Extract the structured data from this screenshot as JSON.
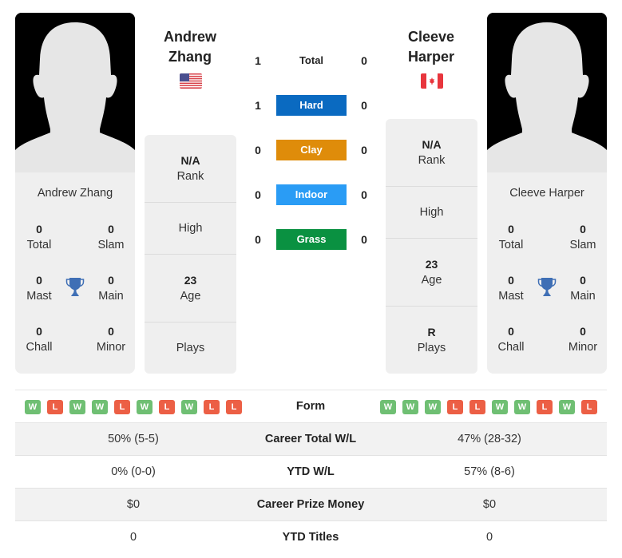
{
  "players": {
    "left": {
      "name_line1": "Andrew",
      "name_line2": "Zhang",
      "full_name": "Andrew Zhang",
      "country_flag": "us-flag-icon",
      "titles": {
        "total": {
          "value": "0",
          "label": "Total"
        },
        "slam": {
          "value": "0",
          "label": "Slam"
        },
        "mast": {
          "value": "0",
          "label": "Mast"
        },
        "main": {
          "value": "0",
          "label": "Main"
        },
        "chall": {
          "value": "0",
          "label": "Chall"
        },
        "minor": {
          "value": "0",
          "label": "Minor"
        }
      },
      "info": {
        "rank": {
          "value": "N/A",
          "label": "Rank"
        },
        "high": {
          "value": "",
          "label": "High"
        },
        "age": {
          "value": "23",
          "label": "Age"
        },
        "plays": {
          "value": "",
          "label": "Plays"
        }
      },
      "form": [
        "W",
        "L",
        "W",
        "W",
        "L",
        "W",
        "L",
        "W",
        "L",
        "L"
      ]
    },
    "right": {
      "name_line1": "Cleeve",
      "name_line2": "Harper",
      "full_name": "Cleeve Harper",
      "country_flag": "canada-flag-icon",
      "titles": {
        "total": {
          "value": "0",
          "label": "Total"
        },
        "slam": {
          "value": "0",
          "label": "Slam"
        },
        "mast": {
          "value": "0",
          "label": "Mast"
        },
        "main": {
          "value": "0",
          "label": "Main"
        },
        "chall": {
          "value": "0",
          "label": "Chall"
        },
        "minor": {
          "value": "0",
          "label": "Minor"
        }
      },
      "info": {
        "rank": {
          "value": "N/A",
          "label": "Rank"
        },
        "high": {
          "value": "",
          "label": "High"
        },
        "age": {
          "value": "23",
          "label": "Age"
        },
        "plays": {
          "value": "R",
          "label": "Plays"
        }
      },
      "form": [
        "W",
        "W",
        "W",
        "L",
        "L",
        "W",
        "W",
        "L",
        "W",
        "L"
      ]
    }
  },
  "h2h": [
    {
      "label": "Total",
      "left": "1",
      "right": "0",
      "color": ""
    },
    {
      "label": "Hard",
      "left": "1",
      "right": "0",
      "color": "#0a6ac1"
    },
    {
      "label": "Clay",
      "left": "0",
      "right": "0",
      "color": "#df8c0a"
    },
    {
      "label": "Indoor",
      "left": "0",
      "right": "0",
      "color": "#2a9cf5"
    },
    {
      "label": "Grass",
      "left": "0",
      "right": "0",
      "color": "#0a9141"
    }
  ],
  "form_label": "Form",
  "form_colors": {
    "W": "#6fbf73",
    "L": "#ec5f45"
  },
  "stats": [
    {
      "label": "Career Total W/L",
      "left": "50% (5-5)",
      "right": "47% (28-32)"
    },
    {
      "label": "YTD W/L",
      "left": "0% (0-0)",
      "right": "57% (8-6)"
    },
    {
      "label": "Career Prize Money",
      "left": "$0",
      "right": "$0"
    },
    {
      "label": "YTD Titles",
      "left": "0",
      "right": "0"
    }
  ]
}
